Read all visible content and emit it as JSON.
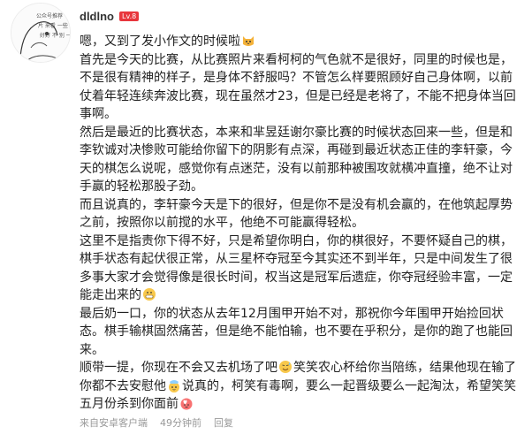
{
  "user": {
    "name": "dldlno",
    "level_badge": "Lv.8",
    "avatar_icon": "avatar-sketch-icon",
    "avatar_text": [
      "公众号推荐",
      "片 来看 一些",
      "好好 不 别 一"
    ]
  },
  "comment": {
    "paragraphs": [
      {
        "segments": [
          {
            "t": "嗯，又到了发小作文的时候啦"
          },
          {
            "emoji": "cat-face-icon"
          }
        ]
      },
      {
        "segments": [
          {
            "t": "首先是今天的比赛，从比赛照片来看柯柯的气色就不是很好，同里的时候也是，不是很有精神的样子，是身体不舒服吗？不管怎么样要照顾好自己身体啊，以前仗着年轻连续奔波比赛，现在虽然才23，但是已经是老将了，不能不把身体当回事啊。"
          }
        ]
      },
      {
        "segments": [
          {
            "t": "然后是最近的比赛状态，本来和芈昱廷谢尔豪比赛的时候状态回来一些，但是和李钦诚对决惨败可能给你留下的阴影有点深，再碰到最近状态正佳的李轩豪，今天的棋怎么说呢，感觉你有点迷茫，没有以前那种被围攻就横冲直撞，绝不让对手赢的轻松那股子劲。"
          }
        ]
      },
      {
        "segments": [
          {
            "t": "而且说真的，李轩豪今天是下的很好，但是你不是没有机会赢的，在他筑起厚势之前，按照你以前搅的水平，他绝不可能赢得轻松。"
          }
        ]
      },
      {
        "segments": [
          {
            "t": "这里不是指责你下得不好，只是希望你明白，你的棋很好，不要怀疑自己的棋，棋手状态有起伏很正常，从三星杯夺冠至今其实还不到半年，只是中间发生了很多事大家才会觉得像是很长时间，权当这是冠军后遗症，你夺冠经验丰富，一定能走出来的"
          },
          {
            "emoji": "grimace-face-icon"
          }
        ]
      },
      {
        "segments": [
          {
            "t": "最后奶一口，你的状态从去年12月围甲开始不对，那祝你今年围甲开始捡回状态。棋手输棋固然痛苦，但是绝不能怕输，也不要在乎积分，是你的跑了也能回来。"
          }
        ]
      },
      {
        "segments": [
          {
            "t": "顺带一提，你现在不会又去机场了吧"
          },
          {
            "emoji": "sweat-smile-icon"
          },
          {
            "t": "笑笑农心杯给你当陪练，结果他现在输了你都不去安慰他"
          },
          {
            "emoji": "pat-head-icon"
          },
          {
            "t": "说真的，柯笑有毒啊，要么一起晋级要么一起淘汰，希望笑笑五月份杀到你面前"
          },
          {
            "emoji": "heart-face-icon"
          }
        ]
      }
    ]
  },
  "meta": {
    "source": "来自安卓客户端",
    "time": "49分钟前",
    "reply": "回复"
  }
}
